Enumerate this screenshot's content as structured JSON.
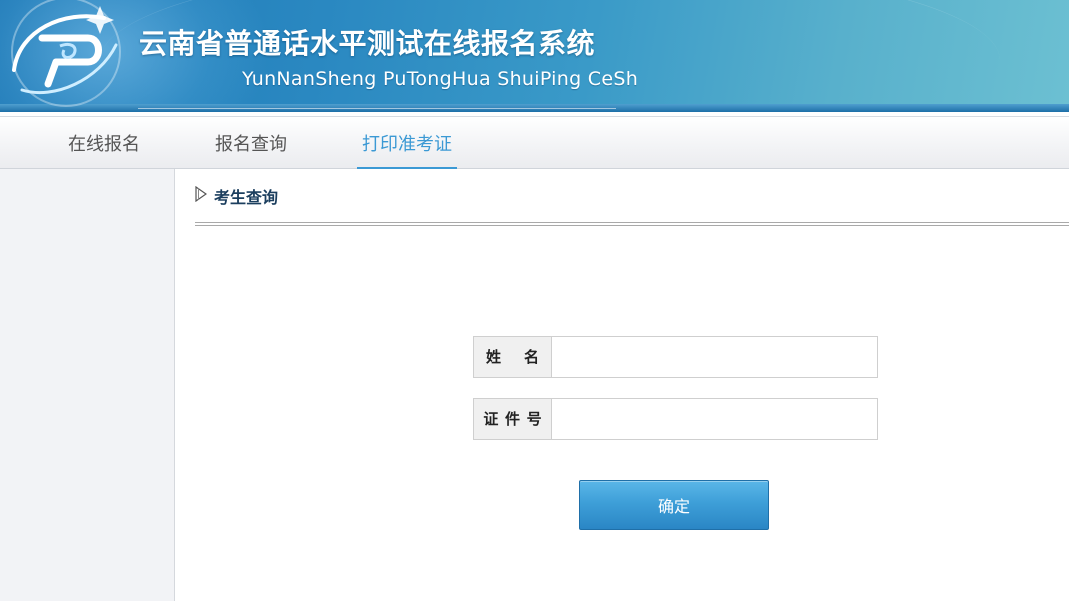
{
  "header": {
    "title": "云南省普通话水平测试在线报名系统",
    "subtitle": "YunNanSheng PuTongHua ShuiPing CeSh",
    "logo_icon": "logo-p-swoosh-icon"
  },
  "nav": {
    "items": [
      {
        "label": "在线报名"
      },
      {
        "label": "报名查询"
      },
      {
        "label": "打印准考证",
        "active": true
      }
    ],
    "active_color": "#3b99d4"
  },
  "main": {
    "section_icon": "triangle-right-icon",
    "section_title": "考生查询",
    "form": {
      "name_label_chars": [
        "姓",
        "名"
      ],
      "name_value": "",
      "id_label_chars": [
        "证",
        "件",
        "号"
      ],
      "id_value": ""
    },
    "confirm_label": "确定"
  },
  "colors": {
    "header_blue": "#2a88c1",
    "button_blue": "#3e9fd8",
    "section_title": "#1b3e5e"
  }
}
